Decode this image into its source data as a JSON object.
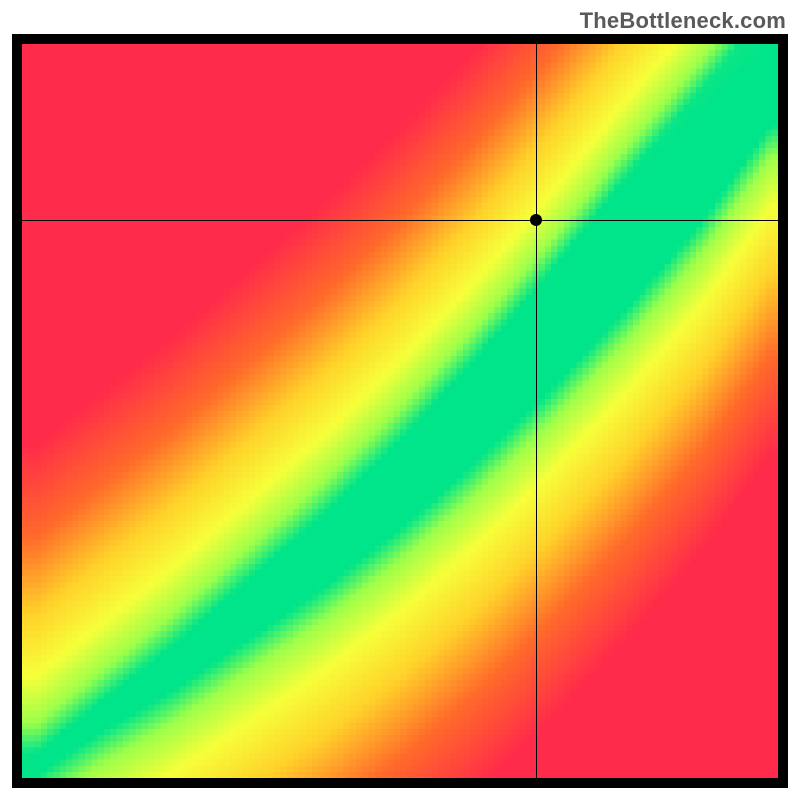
{
  "watermark": "TheBottleneck.com",
  "chart_data": {
    "type": "heatmap",
    "title": "",
    "xlabel": "",
    "ylabel": "",
    "xlim": [
      0,
      100
    ],
    "ylim": [
      0,
      100
    ],
    "grid": false,
    "legend": false,
    "marker": {
      "x": 68,
      "y": 76
    },
    "crosshair": {
      "x": 68,
      "y": 76
    },
    "optimal_band": {
      "description": "green diagonal band where y ≈ f(x); away from band value fades through yellow→orange→red",
      "center_points_xy": [
        [
          2,
          2
        ],
        [
          10,
          8
        ],
        [
          20,
          15
        ],
        [
          30,
          23
        ],
        [
          40,
          31
        ],
        [
          50,
          40
        ],
        [
          60,
          50
        ],
        [
          70,
          61
        ],
        [
          80,
          73
        ],
        [
          90,
          85
        ],
        [
          99,
          97
        ]
      ],
      "band_halfwidth_y": [
        1.5,
        2,
        3,
        4,
        5,
        6,
        7,
        8,
        9,
        9,
        8
      ]
    },
    "colorscale": [
      [
        0.0,
        "#ff2b4a"
      ],
      [
        0.3,
        "#ff6a2a"
      ],
      [
        0.55,
        "#ffd22a"
      ],
      [
        0.75,
        "#f6ff3a"
      ],
      [
        0.9,
        "#9dff4a"
      ],
      [
        1.0,
        "#00e48a"
      ]
    ]
  }
}
